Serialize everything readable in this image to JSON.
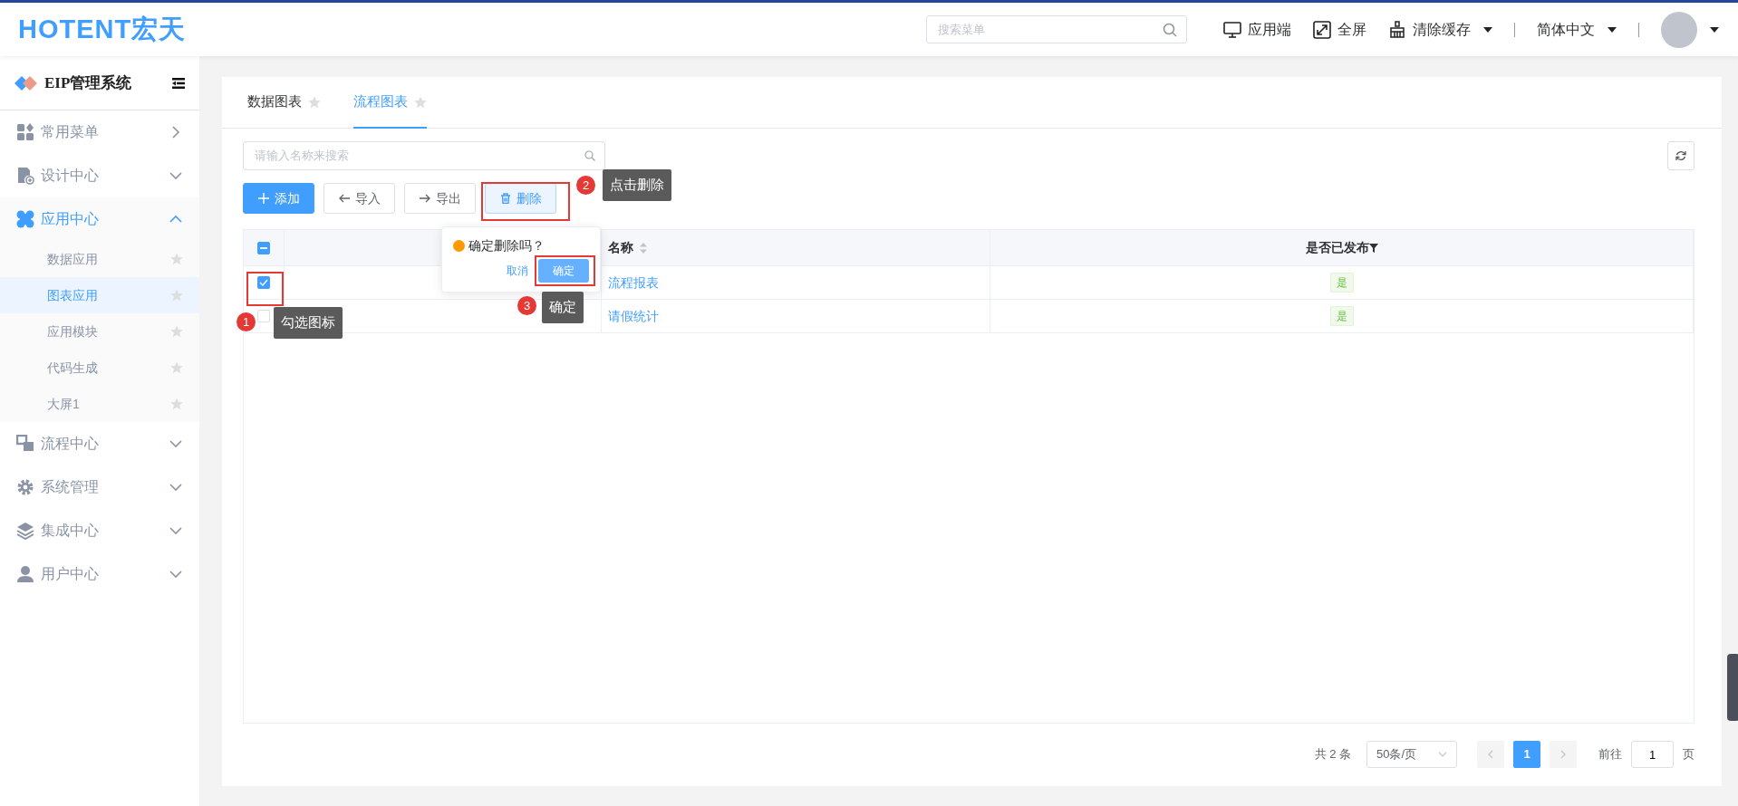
{
  "header": {
    "logo": "HOTENT宏天",
    "search": {
      "placeholder": "搜索菜单"
    },
    "actions": [
      {
        "kind": "monitor",
        "label": "应用端",
        "dropdown": false
      },
      {
        "kind": "fullscreen",
        "label": "全屏",
        "dropdown": false
      },
      {
        "kind": "broom",
        "label": "清除缓存",
        "dropdown": true
      }
    ],
    "language": {
      "label": "简体中文"
    }
  },
  "sidebar": {
    "title": "EIP管理系统",
    "items": [
      {
        "kind": "grid",
        "label": "常用菜单",
        "flyout": true,
        "expanded": false
      },
      {
        "kind": "doc",
        "label": "设计中心",
        "flyout": false,
        "expanded": false
      },
      {
        "kind": "apps",
        "label": "应用中心",
        "flyout": false,
        "expanded": true,
        "children": [
          {
            "label": "数据应用",
            "selected": false
          },
          {
            "label": "图表应用",
            "selected": true
          },
          {
            "label": "应用模块",
            "selected": false
          },
          {
            "label": "代码生成",
            "selected": false
          },
          {
            "label": "大屏1",
            "selected": false
          }
        ]
      },
      {
        "kind": "flow",
        "label": "流程中心",
        "flyout": false,
        "expanded": false
      },
      {
        "kind": "gear",
        "label": "系统管理",
        "flyout": false,
        "expanded": false
      },
      {
        "kind": "layers",
        "label": "集成中心",
        "flyout": false,
        "expanded": false
      },
      {
        "kind": "user",
        "label": "用户中心",
        "flyout": false,
        "expanded": false
      }
    ]
  },
  "tabs": [
    {
      "label": "数据图表",
      "selected": false
    },
    {
      "label": "流程图表",
      "selected": true
    }
  ],
  "search": {
    "placeholder": "请输入名称来搜索"
  },
  "toolbar": [
    {
      "kind": "add",
      "label": "添加"
    },
    {
      "kind": "import",
      "label": "导入"
    },
    {
      "kind": "export",
      "label": "导出"
    },
    {
      "kind": "delete",
      "label": "删除"
    }
  ],
  "table": {
    "header_indeterminate": true,
    "columns": [
      {
        "label": "名称",
        "sortable": true,
        "filter": false
      },
      {
        "label": "是否已发布",
        "sortable": false,
        "filter": true
      }
    ],
    "rows": [
      {
        "checked": true,
        "name": "流程报表",
        "published": "是"
      },
      {
        "checked": false,
        "name": "请假统计",
        "published": "是"
      }
    ]
  },
  "popconfirm": {
    "message": "确定删除吗？",
    "cancel": "取消",
    "confirm": "确定"
  },
  "annotations": [
    {
      "number": "1",
      "text": "勾选图标"
    },
    {
      "number": "2",
      "text": "点击删除"
    },
    {
      "number": "3",
      "text": "确定"
    }
  ],
  "pagination": {
    "total": "共 2 条",
    "page_size": "50条/页",
    "pages": [
      {
        "label": "1",
        "selected": true
      }
    ],
    "goto_label": "前往",
    "goto_value": "1",
    "page_unit": "页"
  }
}
